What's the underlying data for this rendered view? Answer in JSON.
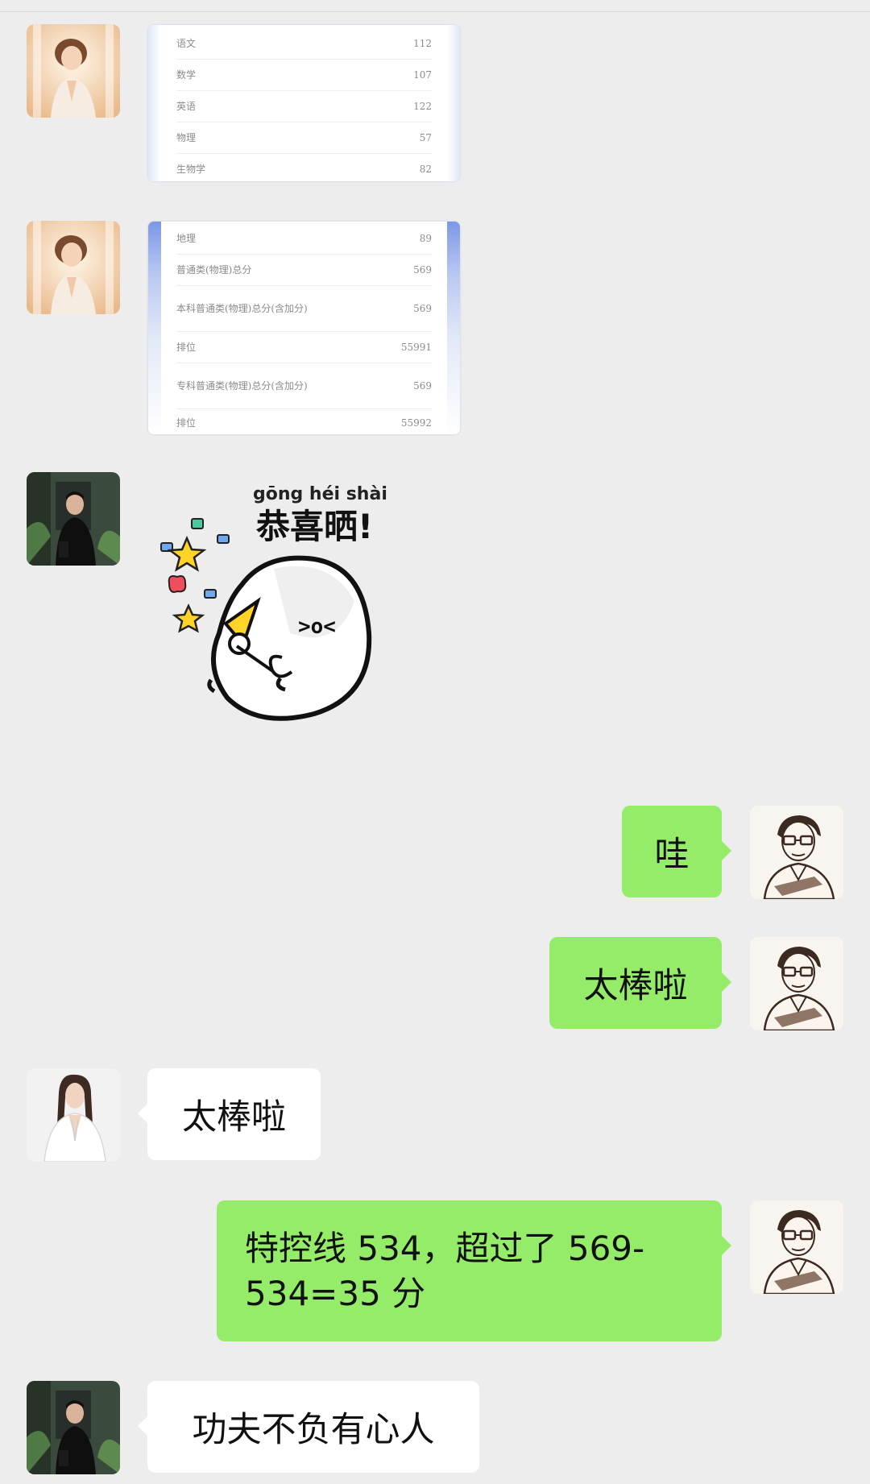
{
  "messages": [
    {
      "kind": "image",
      "card_rows": [
        {
          "label": "语文",
          "value": "112"
        },
        {
          "label": "数学",
          "value": "107"
        },
        {
          "label": "英语",
          "value": "122"
        },
        {
          "label": "物理",
          "value": "57"
        },
        {
          "label": "生物学",
          "value": "82"
        }
      ]
    },
    {
      "kind": "image",
      "card_rows": [
        {
          "label": "地理",
          "value": "89"
        },
        {
          "label": "普通类(物理)总分",
          "value": "569"
        },
        {
          "label": "本科普通类(物理)总分(含加分)",
          "value": "569"
        },
        {
          "label": "排位",
          "value": "55991"
        },
        {
          "label": "专科普通类(物理)总分(含加分)",
          "value": "569"
        },
        {
          "label": "排位",
          "value": "55992"
        }
      ]
    },
    {
      "kind": "sticker",
      "sticker_pinyin": "gōng héi shài",
      "sticker_text": "恭喜晒!",
      "sticker_face": ">o<"
    },
    {
      "kind": "text",
      "side": "right",
      "text": "哇"
    },
    {
      "kind": "text",
      "side": "right",
      "text": "太棒啦"
    },
    {
      "kind": "text",
      "side": "left",
      "text": "太棒啦"
    },
    {
      "kind": "text",
      "side": "right",
      "text": "特控线 534，超过了 569-\n534=35 分"
    },
    {
      "kind": "text",
      "side": "left",
      "text": "功夫不负有心人"
    }
  ],
  "colors": {
    "background": "#ededed",
    "bubble_sent": "#95ec69",
    "bubble_received": "#ffffff"
  },
  "icons": {
    "avatar_a": "woman-praying-avatar",
    "avatar_b": "man-in-black-avatar",
    "avatar_c": "sketch-man-avatar",
    "avatar_d": "woman-in-white-avatar"
  }
}
